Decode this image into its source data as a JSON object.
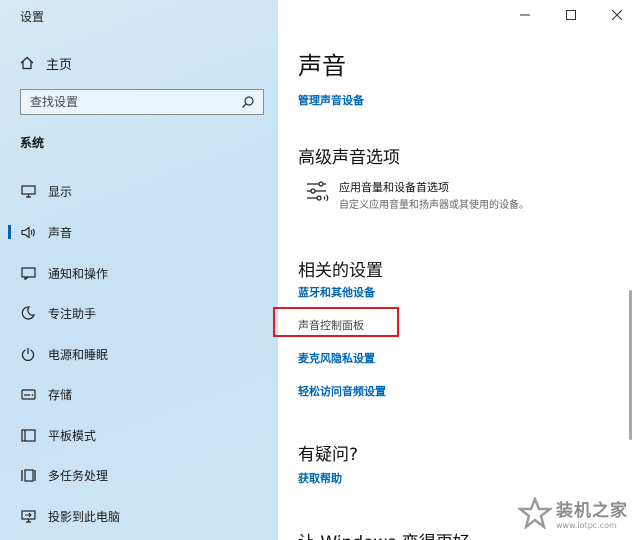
{
  "window": {
    "title": "设置"
  },
  "sidebar": {
    "home_label": "主页",
    "search_placeholder": "查找设置",
    "section_label": "系统",
    "items": [
      {
        "label": "显示",
        "icon": "monitor-icon"
      },
      {
        "label": "声音",
        "icon": "speaker-icon",
        "active": true
      },
      {
        "label": "通知和操作",
        "icon": "notification-icon"
      },
      {
        "label": "专注助手",
        "icon": "moon-icon"
      },
      {
        "label": "电源和睡眠",
        "icon": "power-icon"
      },
      {
        "label": "存储",
        "icon": "storage-icon"
      },
      {
        "label": "平板模式",
        "icon": "tablet-icon"
      },
      {
        "label": "多任务处理",
        "icon": "multitask-icon"
      },
      {
        "label": "投影到此电脑",
        "icon": "project-icon"
      }
    ]
  },
  "main": {
    "title": "声音",
    "manage_devices_link": "管理声音设备",
    "advanced": {
      "heading": "高级声音选项",
      "item_title": "应用音量和设备首选项",
      "item_desc": "自定义应用音量和扬声器或其使用的设备。"
    },
    "related": {
      "heading": "相关的设置",
      "links": [
        "蓝牙和其他设备",
        "声音控制面板",
        "麦克风隐私设置",
        "轻松访问音频设置"
      ]
    },
    "questions": {
      "heading": "有疑问?",
      "help_link": "获取帮助"
    },
    "cutoff_text": "让 Windows 变得更好"
  },
  "watermark": {
    "text": "装机之家",
    "url": "www.lotpc.com"
  },
  "colors": {
    "accent": "#0067b8",
    "highlight": "#e01b24"
  }
}
